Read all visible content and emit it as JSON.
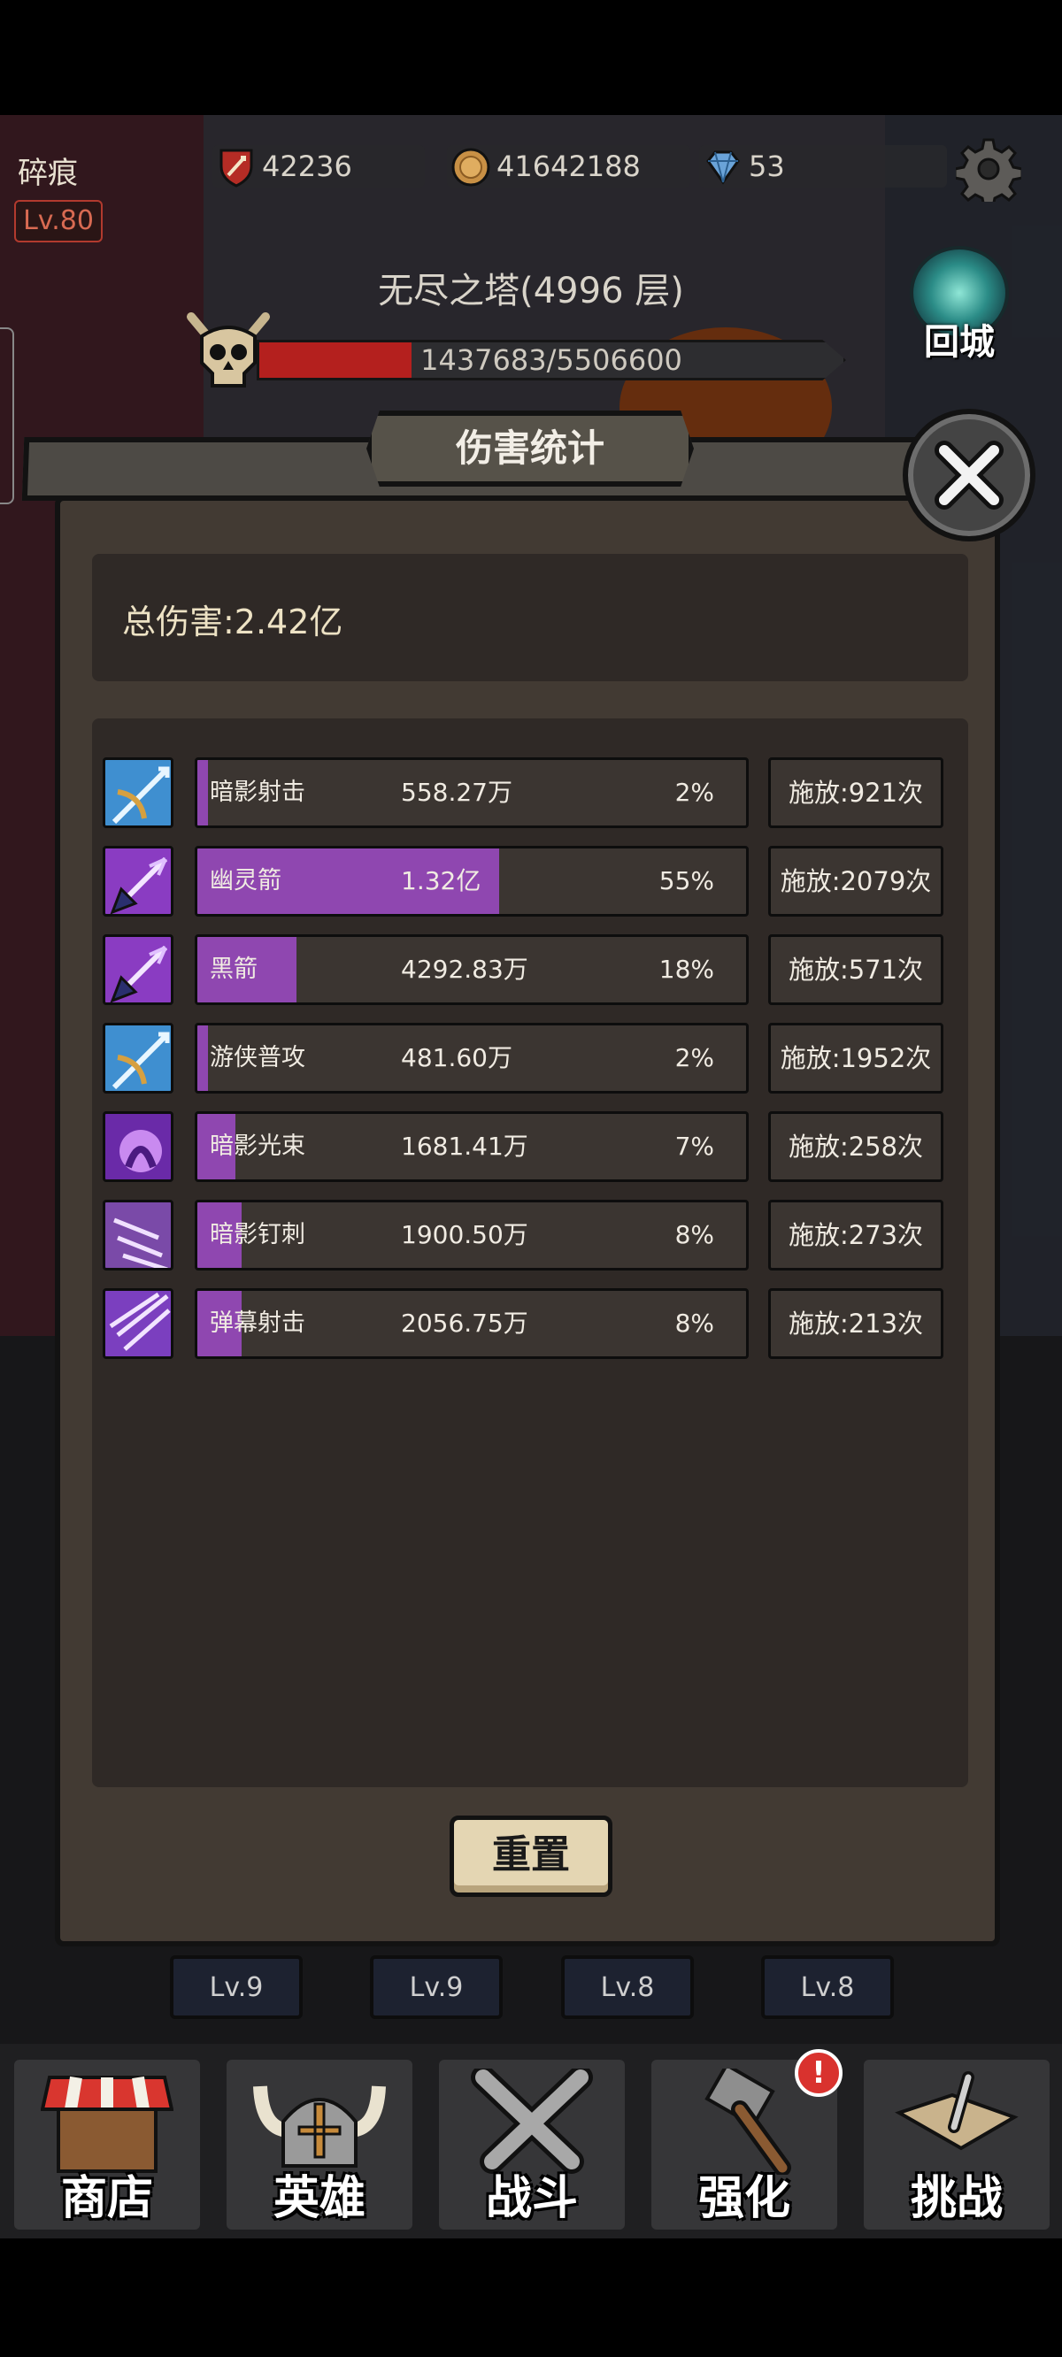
{
  "hud": {
    "player_name": "碎痕",
    "player_level": "Lv.80",
    "power": "42236",
    "gold": "41642188",
    "gems": "53"
  },
  "stage": {
    "title": "无尽之塔(4996 层)",
    "boss_hp_text": "1437683/5506600",
    "boss_hp_fraction": 0.261,
    "return_label": "回城"
  },
  "modal": {
    "title": "伤害统计",
    "total_damage": "总伤害:2.42亿",
    "reset_label": "重置",
    "rows": [
      {
        "name": "暗影射击",
        "value": "558.27万",
        "pct": "2%",
        "fill": 0.02,
        "cast": "施放:921次",
        "icon": "crossbow-icon"
      },
      {
        "name": "幽灵箭",
        "value": "1.32亿",
        "pct": "55%",
        "fill": 0.55,
        "cast": "施放:2079次",
        "icon": "arrow-icon"
      },
      {
        "name": "黑箭",
        "value": "4292.83万",
        "pct": "18%",
        "fill": 0.18,
        "cast": "施放:571次",
        "icon": "arrow-icon"
      },
      {
        "name": "游侠普攻",
        "value": "481.60万",
        "pct": "2%",
        "fill": 0.02,
        "cast": "施放:1952次",
        "icon": "crossbow-icon"
      },
      {
        "name": "暗影光束",
        "value": "1681.41万",
        "pct": "7%",
        "fill": 0.07,
        "cast": "施放:258次",
        "icon": "shadow-beam-icon"
      },
      {
        "name": "暗影钉刺",
        "value": "1900.50万",
        "pct": "8%",
        "fill": 0.08,
        "cast": "施放:273次",
        "icon": "shadow-spike-icon"
      },
      {
        "name": "弹幕射击",
        "value": "2056.75万",
        "pct": "8%",
        "fill": 0.08,
        "cast": "施放:213次",
        "icon": "barrage-icon"
      }
    ]
  },
  "skill_levels": [
    "Lv.9",
    "Lv.9",
    "Lv.8",
    "Lv.8"
  ],
  "nav": {
    "shop": "商店",
    "hero": "英雄",
    "battle": "战斗",
    "enhance": "强化",
    "challenge": "挑战",
    "enhance_badge": "!"
  },
  "colors": {
    "bar_fill": "#8f47b0",
    "panel": "#423a33",
    "hp_fill": "#b4201e"
  }
}
